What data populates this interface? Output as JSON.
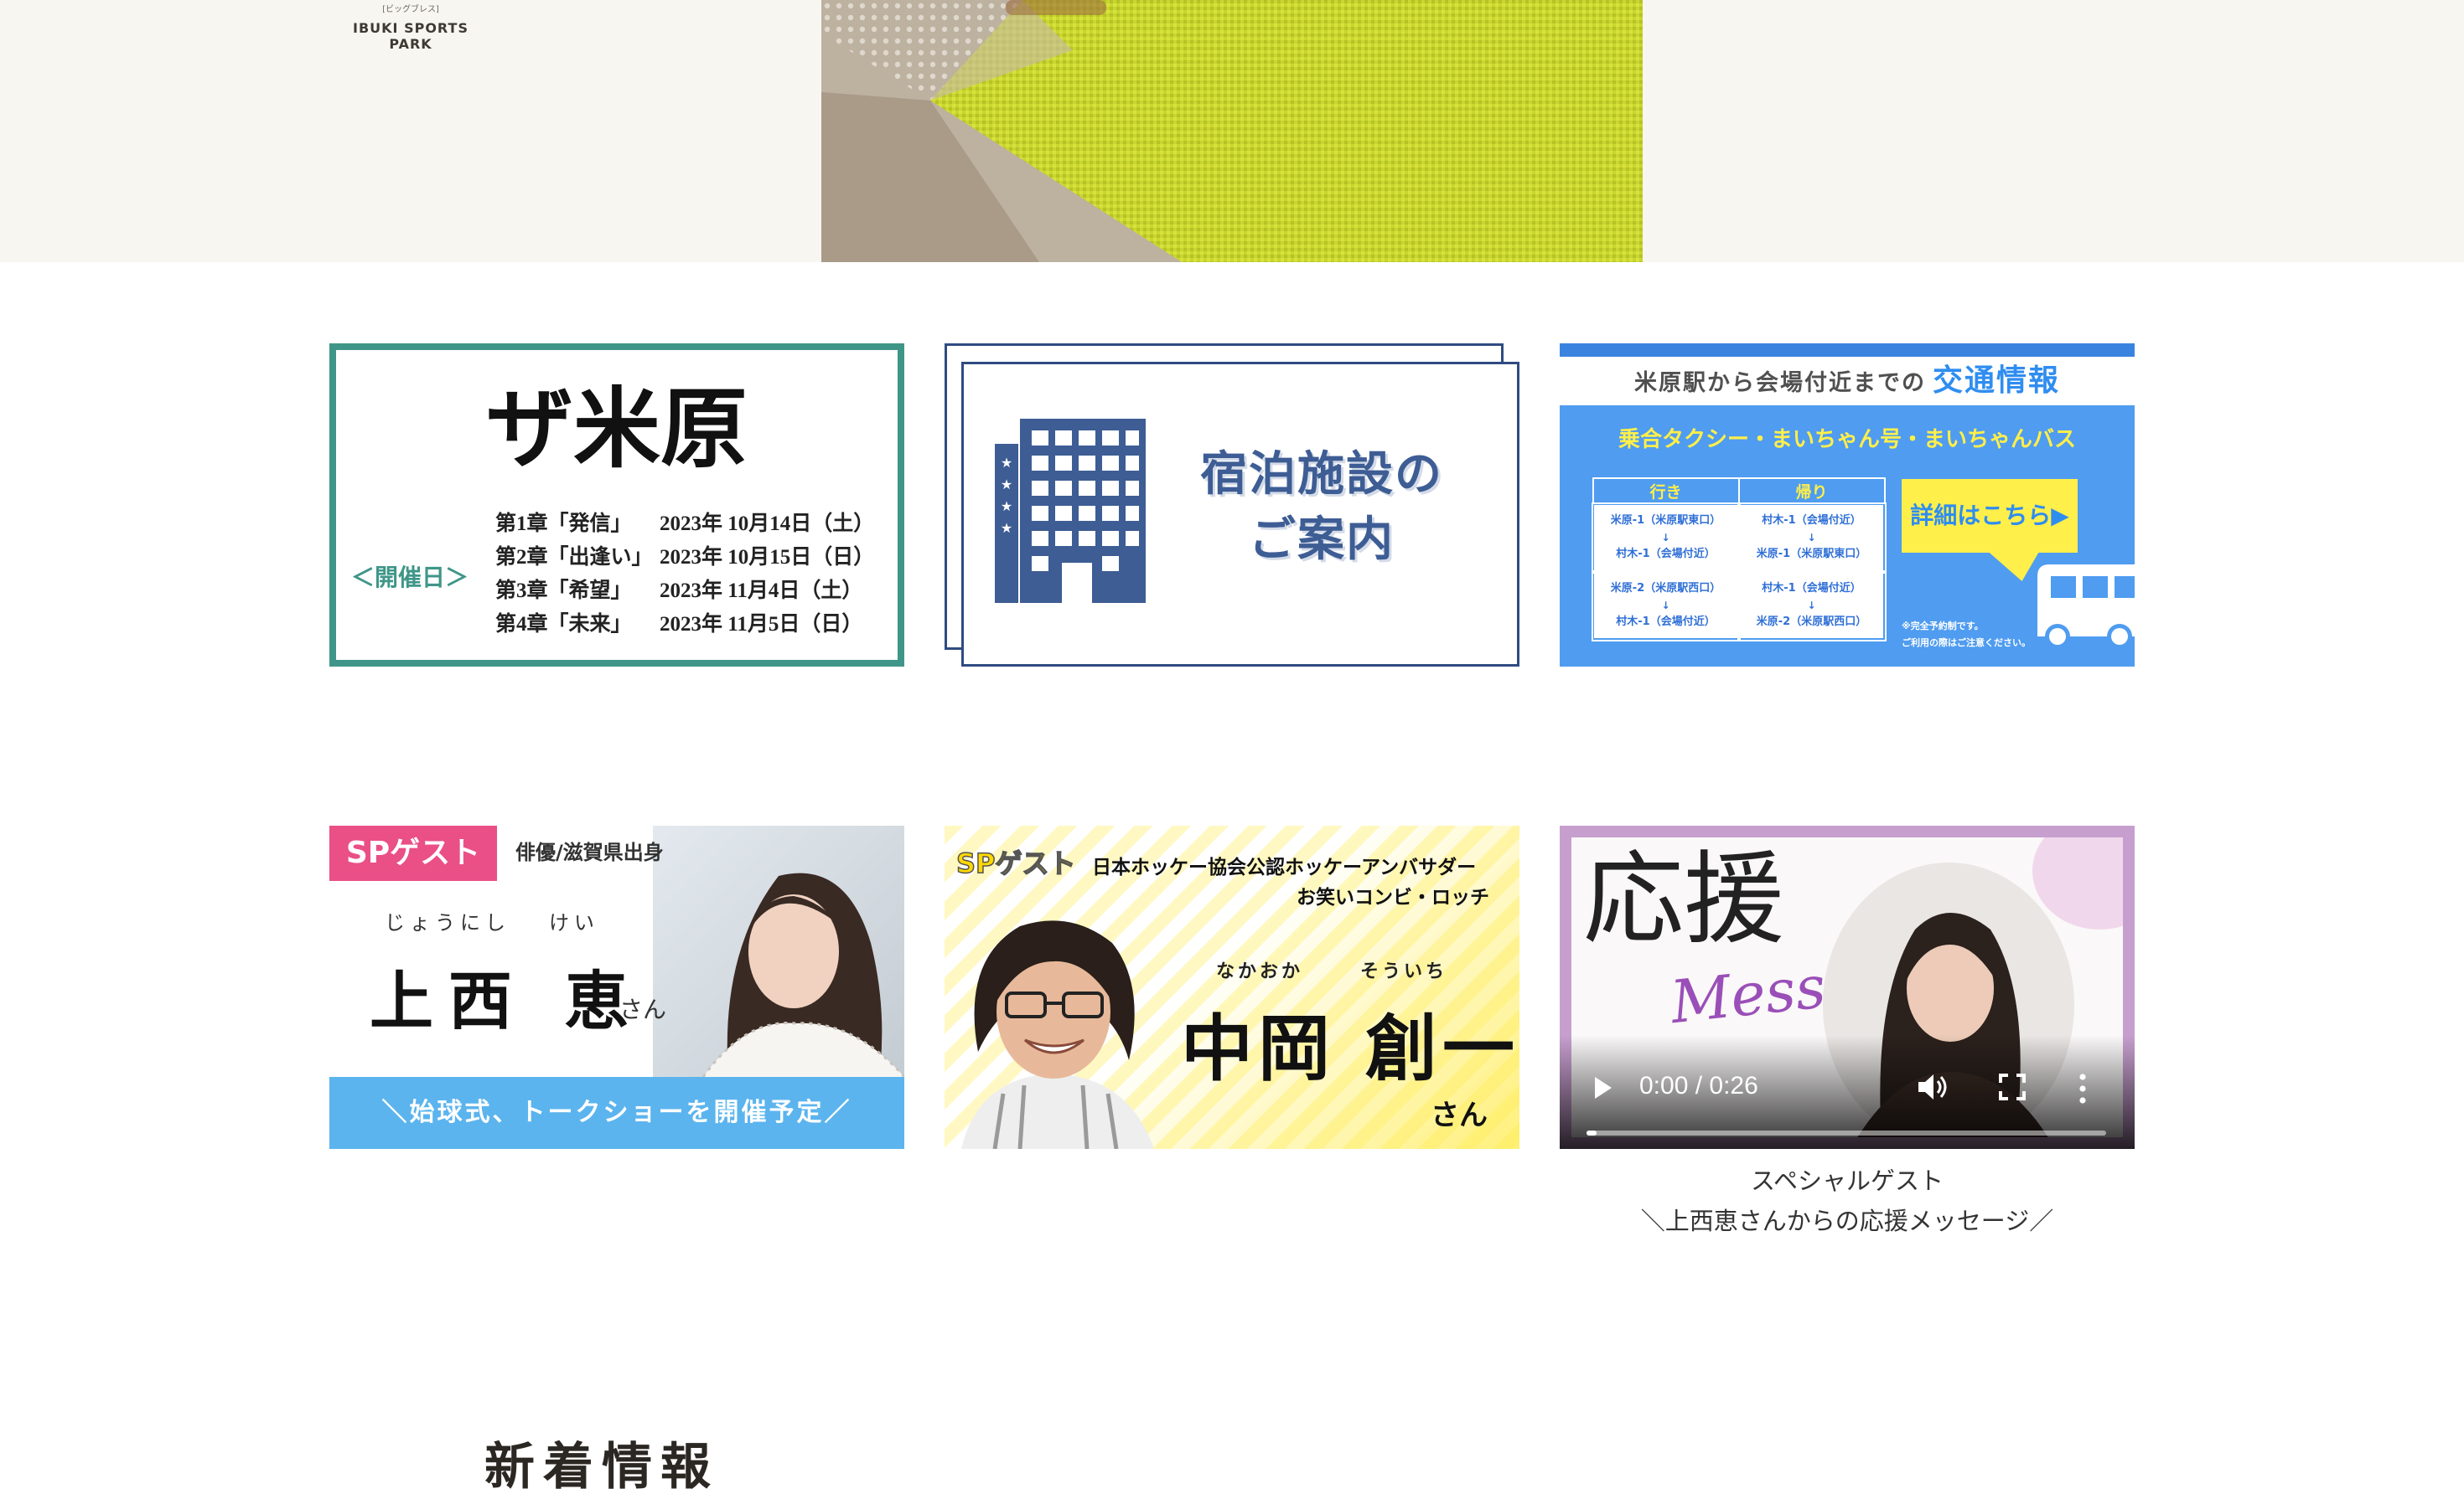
{
  "header": {
    "venue_sub": "[ビッグブレス]",
    "venue_name": "IBUKI SPORTS PARK"
  },
  "banners": {
    "the_maibara": {
      "logo_text": "ザ米原",
      "event_label": "＜開催日＞",
      "chapters": [
        {
          "name": "第1章「発信」",
          "date": "2023年 10月14日（土）"
        },
        {
          "name": "第2章「出逢い」",
          "date": "2023年 10月15日（日）"
        },
        {
          "name": "第3章「希望」",
          "date": "2023年 11月4日（土）"
        },
        {
          "name": "第4章「未来」",
          "date": "2023年 11月5日（日）"
        }
      ]
    },
    "lodging": {
      "line1": "宿泊施設の",
      "line2": "ご案内",
      "icon": "building-icon"
    },
    "traffic": {
      "header_prefix": "米原駅から会場付近までの",
      "header_strong": "交通情報",
      "subtitle": "乗合タクシー・まいちゃん号・まいちゃんバス",
      "col_outbound": "行き",
      "col_return": "帰り",
      "routes": [
        {
          "outbound_from": "米原-1（米原駅東口）",
          "outbound_to": "村木-1（会場付近）",
          "return_from": "村木-1（会場付近）",
          "return_to": "米原-1（米原駅東口）"
        },
        {
          "outbound_from": "米原-2（米原駅西口）",
          "outbound_to": "村木-1（会場付近）",
          "return_from": "村木-1（会場付近）",
          "return_to": "米原-2（米原駅西口）"
        }
      ],
      "arrow": "↓",
      "details_button": "詳細はこちら▶",
      "note1": "※完全予約制です。",
      "note2": "ご利用の際はご注意ください。",
      "colors": {
        "blue": "#4f9cf0",
        "yellow": "#ffef4a"
      }
    },
    "guest_kamonishi": {
      "badge": "SPゲスト",
      "role": "俳優/滋賀県出身",
      "reading_given": "じょうにし",
      "reading_family": "けい",
      "name": "上西 恵",
      "suffix": "さん",
      "strip": "＼始球式、トークショーを開催予定／"
    },
    "guest_nakaoka": {
      "badge": "SPゲスト",
      "role_line1": "日本ホッケー協会公認ホッケーアンバサダー",
      "role_line2": "お笑いコンビ・ロッチ",
      "reading_family": "なかおか",
      "reading_given": "そういち",
      "name": "中岡 創一",
      "suffix": "さん"
    },
    "video": {
      "title_kanji": "応援",
      "title_script": "Message",
      "time": "0:00 / 0:26",
      "progress": 0.0,
      "caption_line1": "スペシャルゲスト",
      "caption_line2": "＼上西恵さんからの応援メッセージ／",
      "controls": [
        "play-icon",
        "volume-icon",
        "fullscreen-icon",
        "more-icon"
      ]
    }
  },
  "news": {
    "heading": "新着情報"
  }
}
